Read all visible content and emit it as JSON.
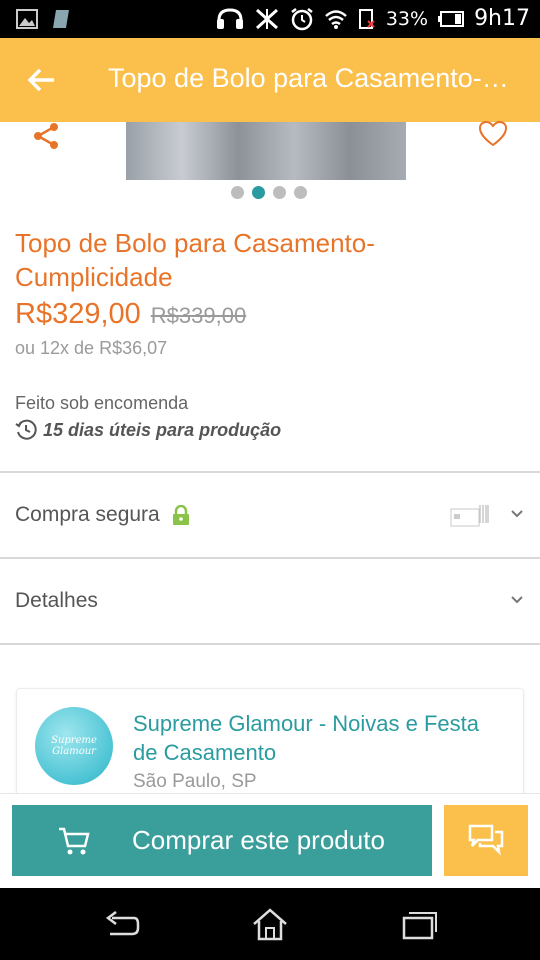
{
  "status_bar": {
    "battery_percent": "33%",
    "time": "9h17",
    "icons": [
      "gallery-icon",
      "sim-card-icon",
      "headset-icon",
      "mute-icon",
      "alarm-icon",
      "wifi-icon",
      "sim-no-signal-icon",
      "battery-icon"
    ]
  },
  "app_bar": {
    "title": "Topo de Bolo para Casamento-Cumplicidade",
    "back_icon": "arrow-left-icon",
    "background": "#fbc04c"
  },
  "gallery": {
    "image_count": 4,
    "active_index": 1,
    "share_icon": "share-icon",
    "favorite_icon": "heart-outline-icon"
  },
  "product": {
    "title": "Topo de Bolo para Casamento-Cumplicidade",
    "price": "R$329,00",
    "old_price": "R$339,00",
    "installments": "ou 12x de R$36,07",
    "made_to_order": "Feito sob encomenda",
    "production_time": "15 dias úteis para produção",
    "accent_color": "#e8742a"
  },
  "sections": {
    "secure_purchase": "Compra segura",
    "details": "Detalhes"
  },
  "store": {
    "name": "Supreme Glamour - Noivas  e Festa de Casamento",
    "location": "São Paulo, SP",
    "avatar_text": "Supreme Glamour",
    "color": "#2a9ca0"
  },
  "actions": {
    "buy_label": "Comprar este produto",
    "buy_color": "#3a9e9b",
    "chat_icon": "chat-bubbles-icon"
  },
  "nav_bar": {
    "icons": [
      "back-nav-icon",
      "home-nav-icon",
      "recent-apps-icon"
    ]
  }
}
